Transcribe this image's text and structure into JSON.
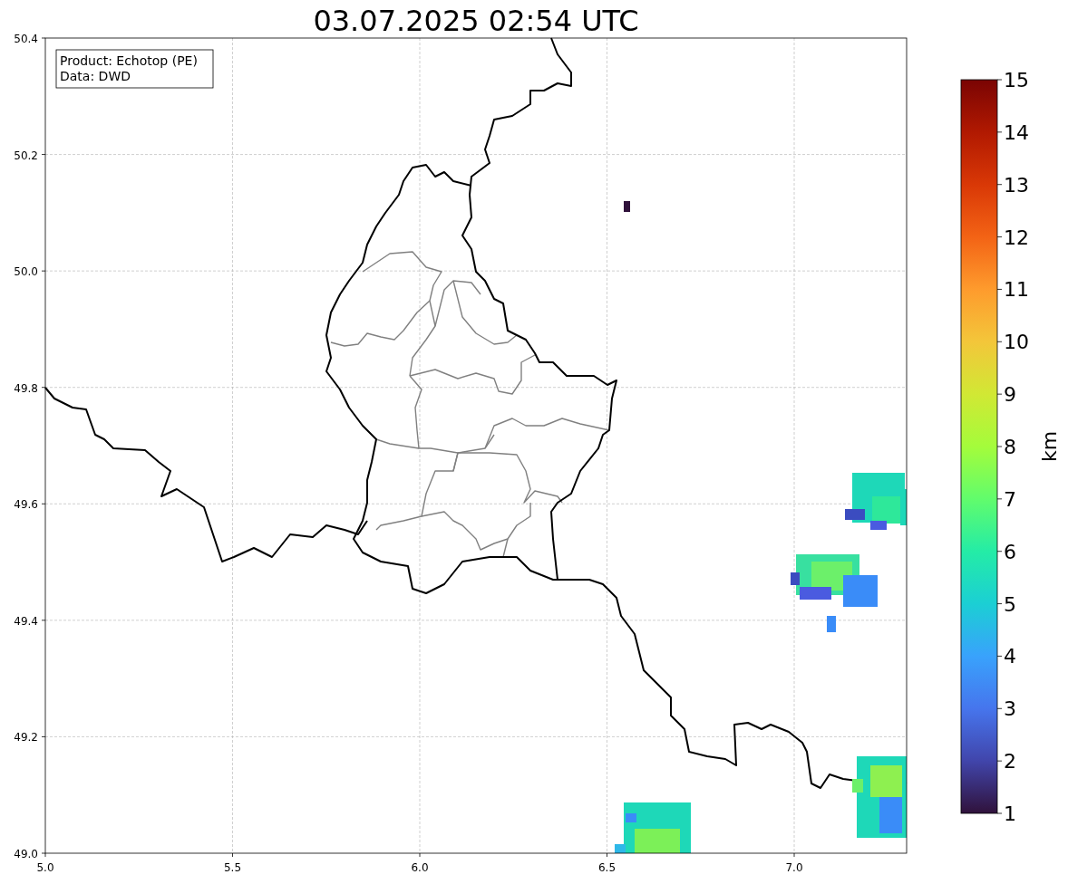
{
  "title": "03.07.2025 02:54 UTC",
  "info_box": [
    "Product: Echotop (PE)",
    "Data: DWD"
  ],
  "map": {
    "xticks": [
      "5.0",
      "5.5",
      "6.0",
      "6.5",
      "7.0"
    ],
    "yticks": [
      "50.4",
      "50.2",
      "50.0",
      "49.8",
      "49.6",
      "49.4",
      "49.2",
      "49.0"
    ]
  },
  "colorbar": {
    "label": "km",
    "ticks": [
      "15",
      "14",
      "13",
      "12",
      "11",
      "10",
      "9",
      "8",
      "7",
      "6",
      "5",
      "4",
      "3",
      "2",
      "1"
    ]
  }
}
